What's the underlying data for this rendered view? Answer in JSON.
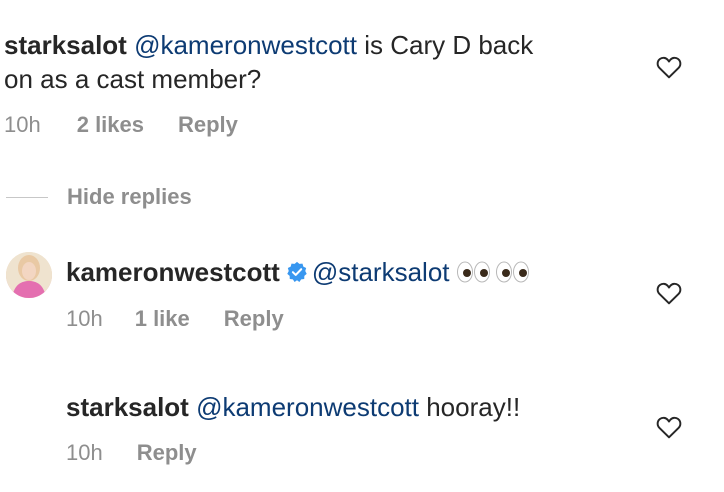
{
  "comments": [
    {
      "username": "starksalot",
      "mention": "@kameronwestcott",
      "text_rest": " is Cary D back",
      "text_line2": "on as a cast member?",
      "time": "10h",
      "likes": "2 likes",
      "reply": "Reply"
    }
  ],
  "hide_replies": "Hide replies",
  "replies": [
    {
      "username": "kameronwestcott",
      "verified": true,
      "mention": "@starksalot",
      "emoji": "eyes-emoji",
      "time": "10h",
      "likes": "1 like",
      "reply": "Reply"
    },
    {
      "username": "starksalot",
      "mention": "@kameronwestcott",
      "text_rest": " hooray!!",
      "time": "10h",
      "reply": "Reply"
    }
  ],
  "colors": {
    "text": "#262626",
    "muted": "#8e8e8e",
    "mention": "#0d3b73",
    "verified": "#3897f0"
  }
}
